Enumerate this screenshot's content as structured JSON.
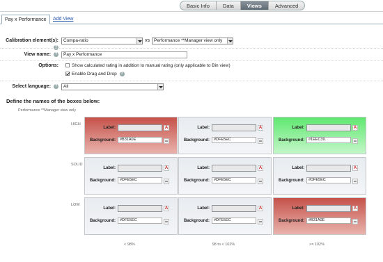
{
  "top_tabs": [
    {
      "label": "Basic Info",
      "active": false
    },
    {
      "label": "Data",
      "active": false
    },
    {
      "label": "Views",
      "active": true
    },
    {
      "label": "Advanced",
      "active": false
    }
  ],
  "view_tabs": {
    "active": "Pay x Performance",
    "add": "Add View"
  },
  "form": {
    "calibration_label": "Calibration element(s):",
    "calibration_x": "Compa-ratio",
    "vs": "vs",
    "calibration_y": "Performance **Manager view only",
    "view_name_label": "View name:",
    "view_name_value": "Pay x Performance",
    "options_label": "Options:",
    "option_1": "Show calculated rating in addition to manual rating (only applicable to Bin view)",
    "option_2": "Enable Drag and Drop",
    "language_label": "Select language:",
    "language_value": "All"
  },
  "grid": {
    "section_title": "Define the names of the boxes below:",
    "y_title": "Performance **Manager view only",
    "row_labels": [
      "HIGH",
      "SOLID",
      "LOW"
    ],
    "col_labels": [
      "< 98%",
      "98 to < 102%",
      ">= 102%"
    ],
    "label_text": "Label:",
    "background_text": "Background:",
    "cells": [
      [
        {
          "bg": "#B31A0E"
        },
        {
          "bg": "#DFE5EC"
        },
        {
          "bg": "#1EEC39."
        }
      ],
      [
        {
          "bg": "#DFE5EC"
        },
        {
          "bg": "#DFE5EC"
        },
        {
          "bg": "#DFE5EC"
        }
      ],
      [
        {
          "bg": "#DFE5EC"
        },
        {
          "bg": "#DFE5EC"
        },
        {
          "bg": "#B31A0E"
        }
      ]
    ]
  },
  "colors": {
    "red": "#B31A0E",
    "green": "#1EEC39",
    "gray": "#DFE5EC"
  }
}
